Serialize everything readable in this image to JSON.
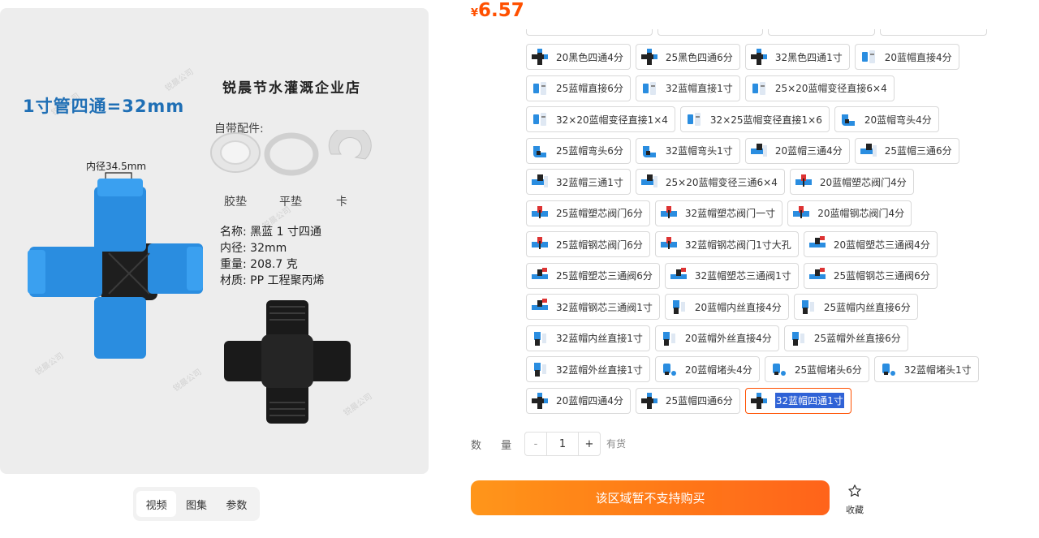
{
  "product_image": {
    "headline": "1寸管四通=32mm",
    "store_name": "锐晨节水灌溉企业店",
    "accessories_title": "自带配件:",
    "accessories": [
      "胶垫",
      "平垫",
      "卡"
    ],
    "inner_dim": "内径34.5mm",
    "specs": [
      "名称: 黑蓝 1 寸四通",
      "内径: 32mm",
      "重量: 208.7 克",
      "材质: PP 工程聚丙烯"
    ]
  },
  "gallery_tabs": [
    "视频",
    "图集",
    "参数"
  ],
  "price": {
    "symbol": "¥",
    "value": "6.57",
    "color": "#ff5000"
  },
  "options": [
    [
      "20黑色四通4分",
      "25黑色四通6分",
      "32黑色四通1寸",
      "20蓝帽直接4分"
    ],
    [
      "25蓝帽直接6分",
      "32蓝帽直接1寸",
      "25×20蓝帽变径直接6×4"
    ],
    [
      "32×20蓝帽变径直接1×4",
      "32×25蓝帽变径直接1×6",
      "20蓝帽弯头4分"
    ],
    [
      "25蓝帽弯头6分",
      "32蓝帽弯头1寸",
      "20蓝帽三通4分",
      "25蓝帽三通6分"
    ],
    [
      "32蓝帽三通1寸",
      "25×20蓝帽变径三通6×4",
      "20蓝帽塑芯阀门4分"
    ],
    [
      "25蓝帽塑芯阀门6分",
      "32蓝帽塑芯阀门一寸",
      "20蓝帽钢芯阀门4分"
    ],
    [
      "25蓝帽钢芯阀门6分",
      "32蓝帽钢芯阀门1寸大孔",
      "20蓝帽塑芯三通阀4分"
    ],
    [
      "25蓝帽塑芯三通阀6分",
      "32蓝帽塑芯三通阀1寸",
      "25蓝帽钢芯三通阀6分"
    ],
    [
      "32蓝帽钢芯三通阀1寸",
      "20蓝帽内丝直接4分",
      "25蓝帽内丝直接6分"
    ],
    [
      "32蓝帽内丝直接1寸",
      "20蓝帽外丝直接4分",
      "25蓝帽外丝直接6分"
    ],
    [
      "32蓝帽外丝直接1寸",
      "20蓝帽堵头4分",
      "25蓝帽堵头6分",
      "32蓝帽堵头1寸"
    ],
    [
      "20蓝帽四通4分",
      "25蓝帽四通6分",
      "32蓝帽四通1寸"
    ]
  ],
  "option_icons": [
    [
      "cross-fitting-icon",
      "cross-fitting-icon",
      "cross-fitting-icon",
      "straight-fitting-icon"
    ],
    [
      "straight-fitting-icon",
      "straight-fitting-icon",
      "straight-fitting-icon"
    ],
    [
      "straight-fitting-icon",
      "straight-fitting-icon",
      "elbow-fitting-icon"
    ],
    [
      "elbow-fitting-icon",
      "elbow-fitting-icon",
      "tee-fitting-icon",
      "tee-fitting-icon"
    ],
    [
      "tee-fitting-icon",
      "tee-fitting-icon",
      "valve-fitting-icon"
    ],
    [
      "valve-fitting-icon",
      "valve-fitting-icon",
      "valve-fitting-icon"
    ],
    [
      "valve-fitting-icon",
      "valve-fitting-icon",
      "tee-valve-fitting-icon"
    ],
    [
      "tee-valve-fitting-icon",
      "tee-valve-fitting-icon",
      "tee-valve-fitting-icon"
    ],
    [
      "tee-valve-fitting-icon",
      "threaded-fitting-icon",
      "threaded-fitting-icon"
    ],
    [
      "threaded-fitting-icon",
      "threaded-fitting-icon",
      "threaded-fitting-icon"
    ],
    [
      "threaded-fitting-icon",
      "plug-fitting-icon",
      "plug-fitting-icon",
      "plug-fitting-icon"
    ],
    [
      "cross-fitting-icon",
      "cross-fitting-icon",
      "cross-fitting-icon"
    ]
  ],
  "selected_option": "32蓝帽四通1寸",
  "quantity": {
    "label": "数 量",
    "minus": "-",
    "value": "1",
    "plus": "+",
    "stock": "有货"
  },
  "buy_button": "该区域暂不支持购买",
  "favorite": {
    "label": "收藏",
    "icon": "star-icon"
  },
  "colors": {
    "accent": "#ff5000",
    "blue_cap": "#2a8de0"
  }
}
